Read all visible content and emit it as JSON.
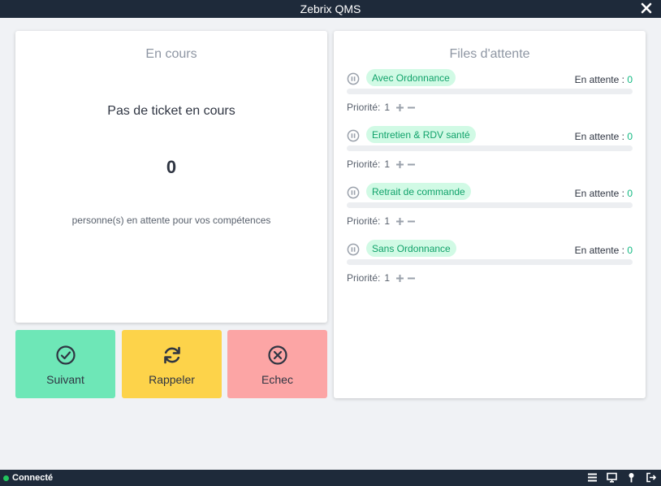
{
  "app": {
    "title": "Zebrix QMS"
  },
  "current": {
    "title": "En cours",
    "no_ticket": "Pas de ticket en cours",
    "count": "0",
    "waiting_label": "personne(s) en attente pour vos compétences"
  },
  "actions": {
    "next": "Suivant",
    "recall": "Rappeler",
    "fail": "Echec"
  },
  "queues": {
    "title": "Files d'attente",
    "waiting_label": "En attente :",
    "priority_label": "Priorité:",
    "items": [
      {
        "name": "Avec Ordonnance",
        "waiting": "0",
        "priority": "1",
        "progress": 0
      },
      {
        "name": "Entretien & RDV santé",
        "waiting": "0",
        "priority": "1",
        "progress": 0
      },
      {
        "name": "Retrait de commande",
        "waiting": "0",
        "priority": "1",
        "progress": 0
      },
      {
        "name": "Sans Ordonnance",
        "waiting": "0",
        "priority": "1",
        "progress": 0
      }
    ]
  },
  "status": {
    "connection": "Connecté"
  },
  "icons": {
    "close": "close-icon",
    "pause": "pause-icon",
    "plus": "plus-icon",
    "minus": "minus-icon",
    "check": "check-circle-icon",
    "refresh": "refresh-icon",
    "x": "x-circle-icon",
    "list": "list-icon",
    "monitor": "monitor-icon",
    "pin": "pin-icon",
    "logout": "logout-icon"
  },
  "colors": {
    "accent": "#10b981",
    "next": "#6ee7b7",
    "recall": "#fdd34a",
    "fail": "#fca5a5",
    "bar": "#1e2a3a"
  }
}
